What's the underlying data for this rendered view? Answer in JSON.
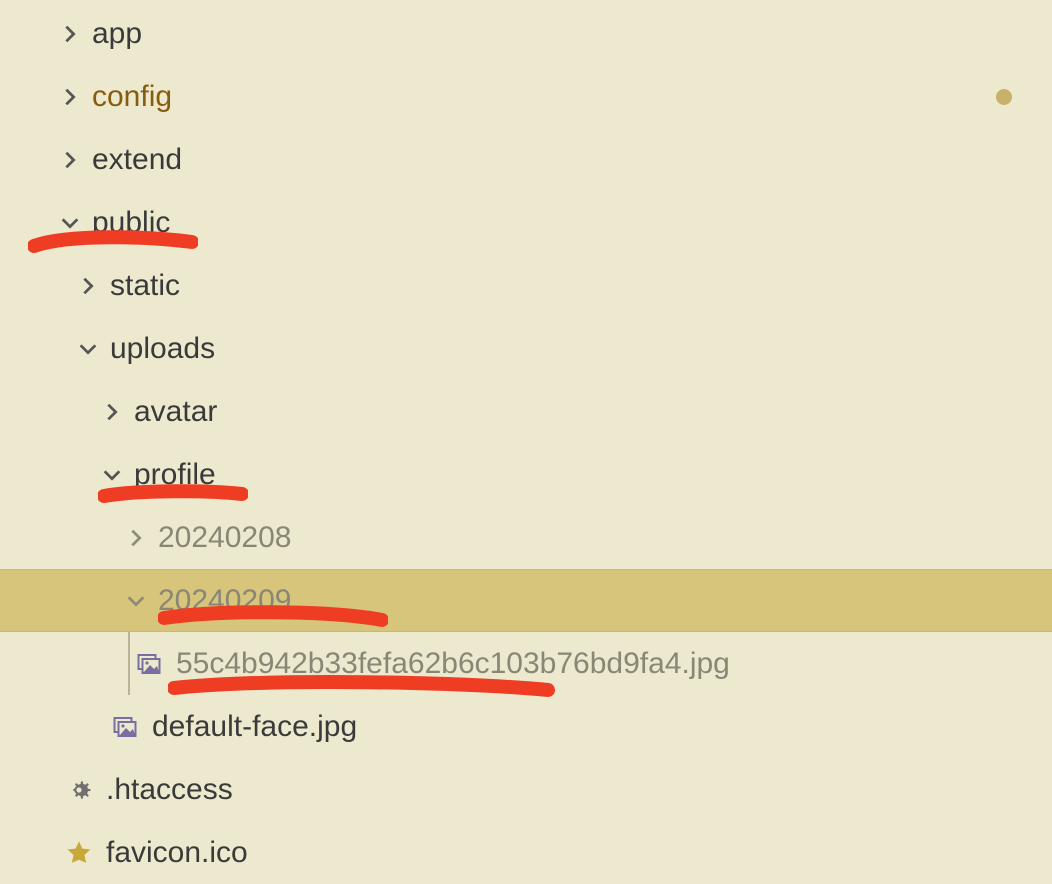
{
  "tree": {
    "app": "app",
    "config": "config",
    "extend": "extend",
    "public": "public",
    "static": "static",
    "uploads": "uploads",
    "avatar": "avatar",
    "profile": "profile",
    "d20240208": "20240208",
    "d20240209": "20240209",
    "hashfile": "55c4b942b33fefa62b6c103b76bd9fa4.jpg",
    "defaultface": "default-face.jpg",
    "htaccess": ".htaccess",
    "favicon": "favicon.ico"
  }
}
